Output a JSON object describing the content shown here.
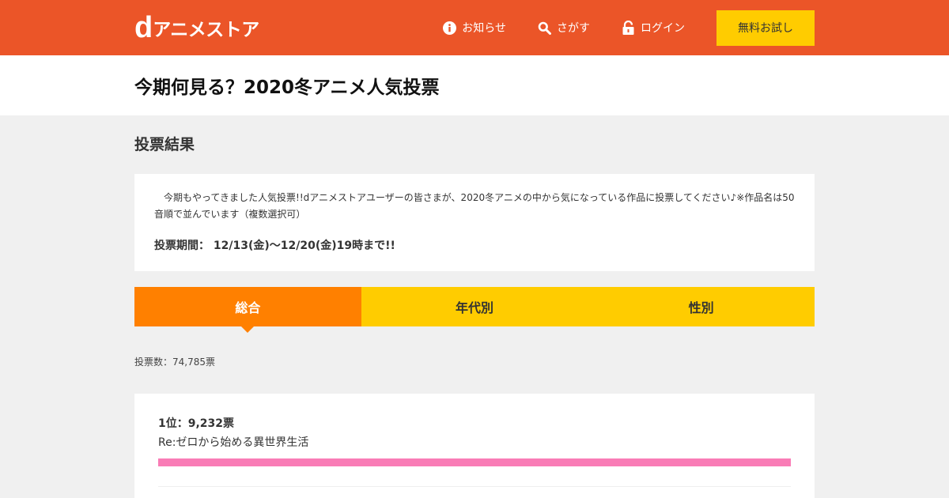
{
  "header": {
    "logo_d": "d",
    "logo_text": "アニメストア",
    "nav": [
      {
        "label": "お知らせ",
        "icon": "info-icon"
      },
      {
        "label": "さがす",
        "icon": "search-icon"
      },
      {
        "label": "ログイン",
        "icon": "lock-icon"
      }
    ],
    "trial_label": "無料お試し"
  },
  "page": {
    "title": "今期何見る？2020冬アニメ人気投票"
  },
  "results_section": {
    "title": "投票結果",
    "description": "今期もやってきました人気投票!!dアニメストアユーザーの皆さまが、2020冬アニメの中から気になっている作品に投票してください♪※作品名は50音順で並んでいます（複数選択可）",
    "period": "投票期間： 12/13(金)～12/20(金)19時まで!!"
  },
  "tabs": [
    {
      "label": "総合",
      "active": true
    },
    {
      "label": "年代別",
      "active": false
    },
    {
      "label": "性別",
      "active": false
    }
  ],
  "vote_total": "投票数：74,785票",
  "rankings": [
    {
      "rank_label": "1位：9,232票",
      "title": "Re:ゼロから始める異世界生活",
      "share": 1.0
    }
  ],
  "colors": {
    "brand": "#eb5528",
    "trial_button": "#ffcc00",
    "tab_active": "#ff8000",
    "tab_inactive": "#ffcc00",
    "bar": "#f97cb6"
  }
}
